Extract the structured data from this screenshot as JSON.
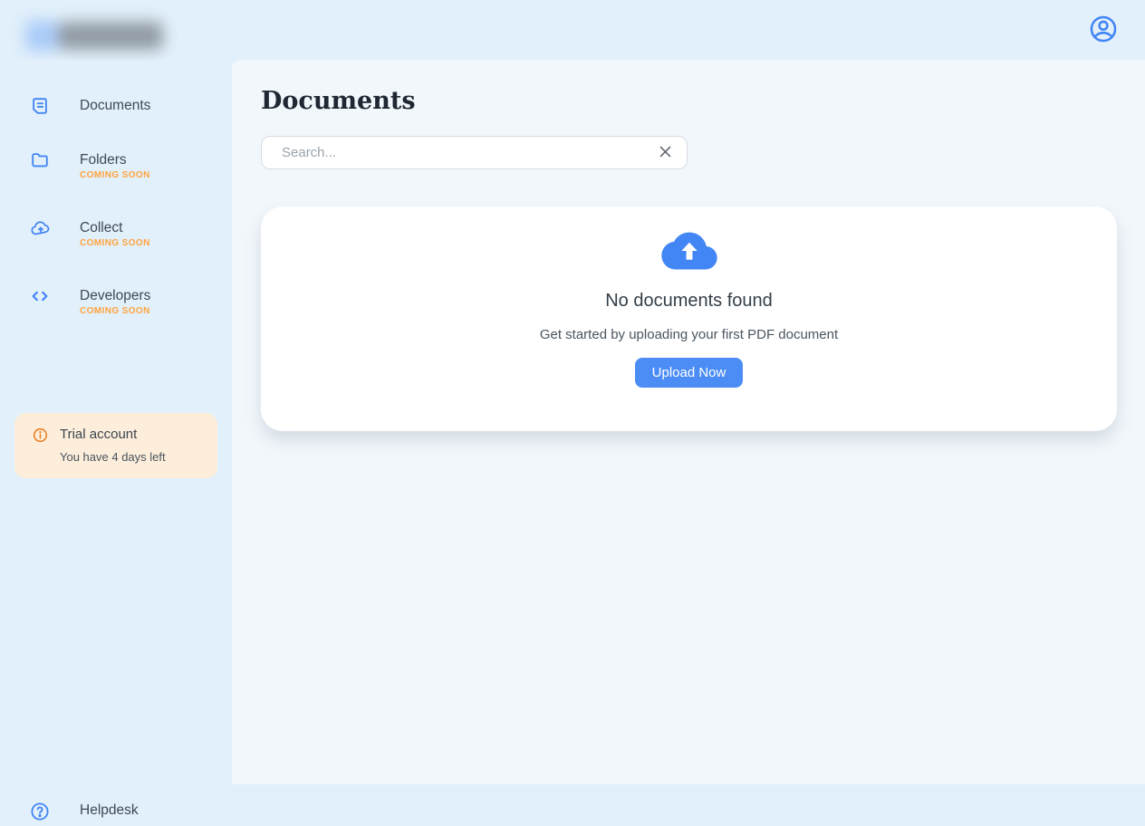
{
  "header": {
    "logo": "blurred-brand-logo",
    "profile_icon": "user-circle-icon"
  },
  "sidebar": {
    "items": [
      {
        "label": "Documents",
        "icon": "document-icon",
        "badge": ""
      },
      {
        "label": "Folders",
        "icon": "folder-icon",
        "badge": "COMING SOON"
      },
      {
        "label": "Collect",
        "icon": "cloud-upload-icon",
        "badge": "COMING SOON"
      },
      {
        "label": "Developers",
        "icon": "code-icon",
        "badge": "COMING SOON"
      }
    ],
    "trial_notice": {
      "icon": "info-circle-icon",
      "title": "Trial account",
      "subtitle": "You have 4 days left"
    },
    "helpdesk": {
      "icon": "help-circle-icon",
      "label": "Helpdesk"
    }
  },
  "main": {
    "title": "Documents",
    "search": {
      "placeholder": "Search...",
      "value": "",
      "clear_icon": "close-x-icon"
    },
    "empty_state": {
      "icon": "cloud-upload-filled-icon",
      "title": "No documents found",
      "subtitle": "Get started by uploading your first PDF document",
      "button_label": "Upload Now"
    }
  },
  "colors": {
    "accent_blue": "#4285f4",
    "button_blue": "#4c8df5",
    "badge_orange": "#ffa33c",
    "trial_icon_orange": "#e8822b",
    "trial_bg": "#fdeedb",
    "sidebar_bg": "#e2f0fb",
    "main_bg": "#f2f7fb",
    "card_bg": "#ffffff"
  }
}
